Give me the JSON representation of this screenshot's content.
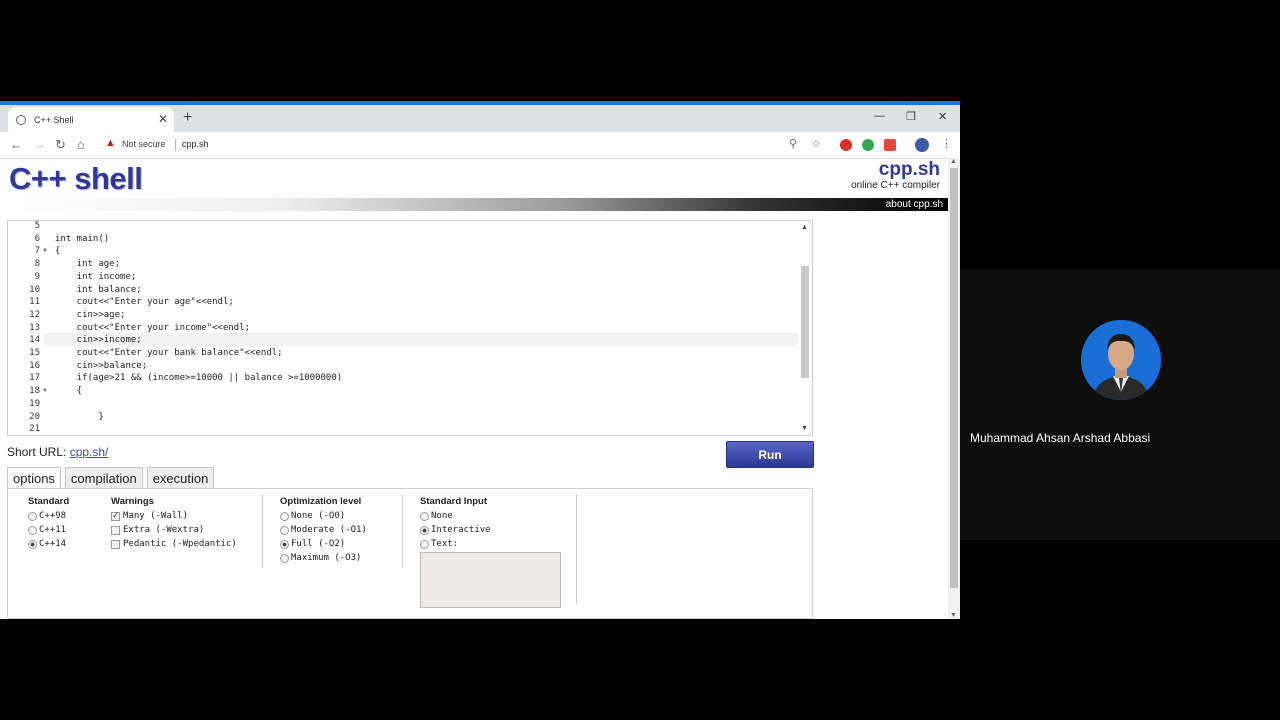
{
  "browser": {
    "tab_title": "C++ Shell",
    "security_label": "Not secure",
    "url": "cpp.sh"
  },
  "site": {
    "logo": "C++ shell",
    "brand_name": "cpp.sh",
    "brand_tagline": "online C++ compiler",
    "about_link": "about cpp.sh"
  },
  "editor": {
    "lines": [
      {
        "num": "5",
        "text": ""
      },
      {
        "num": "6",
        "text": "int main()"
      },
      {
        "num": "7",
        "text": "{"
      },
      {
        "num": "8",
        "text": "    int age;"
      },
      {
        "num": "9",
        "text": "    int income;"
      },
      {
        "num": "10",
        "text": "    int balance;"
      },
      {
        "num": "11",
        "text": "    cout<<\"Enter your age\"<<endl;"
      },
      {
        "num": "12",
        "text": "    cin>>age;"
      },
      {
        "num": "13",
        "text": "    cout<<\"Enter your income\"<<endl;"
      },
      {
        "num": "14",
        "text": "    cin>>income;"
      },
      {
        "num": "15",
        "text": "    cout<<\"Enter your bank balance\"<<endl;"
      },
      {
        "num": "16",
        "text": "    cin>>balance;"
      },
      {
        "num": "17",
        "text": "    if(age>21 && (income>=10000 || balance >=1000000)"
      },
      {
        "num": "18",
        "text": "    {"
      },
      {
        "num": "19",
        "text": ""
      },
      {
        "num": "20",
        "text": "        }"
      },
      {
        "num": "21",
        "text": ""
      }
    ]
  },
  "short_url": {
    "label": "Short URL:",
    "link": "cpp.sh/"
  },
  "run_label": "Run",
  "tabs": [
    "options",
    "compilation",
    "execution"
  ],
  "options": {
    "standard": {
      "title": "Standard",
      "items": [
        "C++98",
        "C++11",
        "C++14"
      ],
      "selected": "C++14"
    },
    "warnings": {
      "title": "Warnings",
      "items": [
        "Many (-Wall)",
        "Extra (-Wextra)",
        "Pedantic (-Wpedantic)"
      ],
      "checked": [
        "Many (-Wall)"
      ]
    },
    "optimization": {
      "title": "Optimization level",
      "items": [
        "None (-O0)",
        "Moderate (-O1)",
        "Full (-O2)",
        "Maximum (-O3)"
      ],
      "selected": "Full (-O2)"
    },
    "stdin": {
      "title": "Standard Input",
      "items": [
        "None",
        "Interactive",
        "Text:"
      ],
      "selected": "Interactive"
    }
  },
  "participant": {
    "name": "Muhammad Ahsan Arshad Abbasi"
  }
}
